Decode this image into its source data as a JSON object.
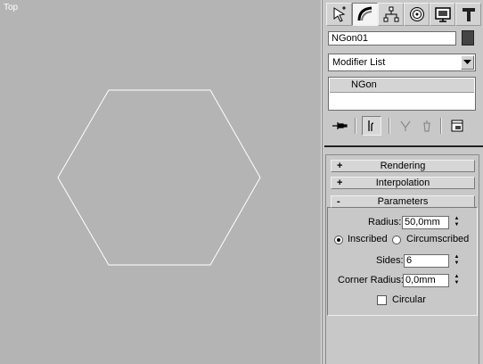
{
  "viewport": {
    "label": "Top"
  },
  "command_panel": {
    "tabs": [
      {
        "name": "create",
        "icon": "create-icon"
      },
      {
        "name": "modify",
        "icon": "modify-icon",
        "active": true
      },
      {
        "name": "hierarchy",
        "icon": "hierarchy-icon"
      },
      {
        "name": "motion",
        "icon": "motion-icon"
      },
      {
        "name": "display",
        "icon": "display-icon"
      },
      {
        "name": "utilities",
        "icon": "utilities-icon"
      }
    ],
    "object_name": "NGon01",
    "object_color": "#444444",
    "modifier_list": "Modifier List",
    "stack_items": [
      "NGon"
    ],
    "rollouts": {
      "rendering": {
        "sign": "+",
        "title": "Rendering"
      },
      "interpolation": {
        "sign": "+",
        "title": "Interpolation"
      },
      "parameters": {
        "sign": "-",
        "title": "Parameters"
      }
    },
    "parameters": {
      "radius_label": "Radius:",
      "radius_value": "50,0mm",
      "inscribed_label": "Inscribed",
      "circumscribed_label": "Circumscribed",
      "inscribed_selected": true,
      "sides_label": "Sides:",
      "sides_value": "6",
      "corner_radius_label": "Corner Radius:",
      "corner_radius_value": "0,0mm",
      "circular_label": "Circular",
      "circular_checked": false
    }
  }
}
